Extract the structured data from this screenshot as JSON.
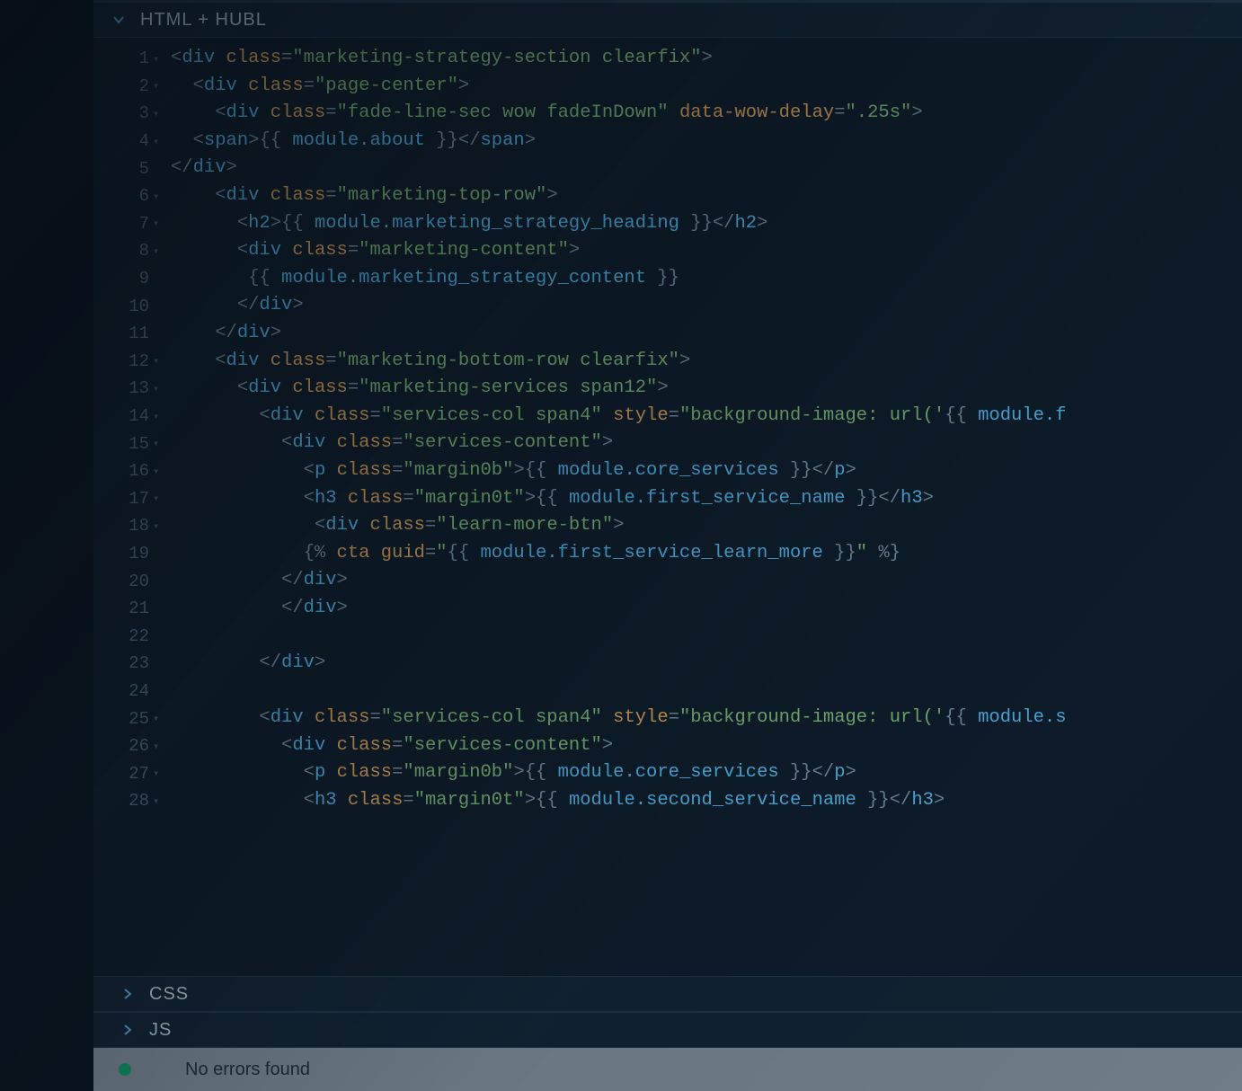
{
  "sections": {
    "html_hubl": "HTML + HUBL",
    "css": "CSS",
    "js": "JS"
  },
  "status_text": "No errors found",
  "code_lines": [
    {
      "n": 1,
      "fold": true,
      "tokens": [
        [
          "punc",
          "<"
        ],
        [
          "tag",
          "div"
        ],
        [
          "punc",
          " "
        ],
        [
          "attr",
          "class"
        ],
        [
          "eq",
          "="
        ],
        [
          "str",
          "\"marketing-strategy-section clearfix\""
        ],
        [
          "punc",
          ">"
        ]
      ]
    },
    {
      "n": 2,
      "fold": true,
      "indent": 2,
      "tokens": [
        [
          "punc",
          "<"
        ],
        [
          "tag",
          "div"
        ],
        [
          "punc",
          " "
        ],
        [
          "attr",
          "class"
        ],
        [
          "eq",
          "="
        ],
        [
          "str",
          "\"page-center\""
        ],
        [
          "punc",
          ">"
        ]
      ]
    },
    {
      "n": 3,
      "fold": true,
      "indent": 4,
      "tokens": [
        [
          "punc",
          "<"
        ],
        [
          "tag",
          "div"
        ],
        [
          "punc",
          " "
        ],
        [
          "attr",
          "class"
        ],
        [
          "eq",
          "="
        ],
        [
          "str",
          "\"fade-line-sec wow fadeInDown\""
        ],
        [
          "punc",
          " "
        ],
        [
          "attr",
          "data-wow-delay"
        ],
        [
          "eq",
          "="
        ],
        [
          "str",
          "\".25s\""
        ],
        [
          "punc",
          ">"
        ]
      ]
    },
    {
      "n": 4,
      "fold": true,
      "indent": 2,
      "tokens": [
        [
          "punc",
          "<"
        ],
        [
          "tag",
          "span"
        ],
        [
          "punc",
          ">"
        ],
        [
          "delim",
          "{{ "
        ],
        [
          "var",
          "module.about"
        ],
        [
          "delim",
          " }}"
        ],
        [
          "punc",
          "</"
        ],
        [
          "tag",
          "span"
        ],
        [
          "punc",
          ">"
        ]
      ]
    },
    {
      "n": 5,
      "fold": false,
      "indent": 0,
      "tokens": [
        [
          "punc",
          "</"
        ],
        [
          "tag",
          "div"
        ],
        [
          "punc",
          ">"
        ]
      ]
    },
    {
      "n": 6,
      "fold": true,
      "indent": 4,
      "tokens": [
        [
          "punc",
          "<"
        ],
        [
          "tag",
          "div"
        ],
        [
          "punc",
          " "
        ],
        [
          "attr",
          "class"
        ],
        [
          "eq",
          "="
        ],
        [
          "str",
          "\"marketing-top-row\""
        ],
        [
          "punc",
          ">"
        ]
      ]
    },
    {
      "n": 7,
      "fold": true,
      "indent": 6,
      "tokens": [
        [
          "punc",
          "<"
        ],
        [
          "tag",
          "h2"
        ],
        [
          "punc",
          ">"
        ],
        [
          "delim",
          "{{ "
        ],
        [
          "var",
          "module.marketing_strategy_heading"
        ],
        [
          "delim",
          " }}"
        ],
        [
          "punc",
          "</"
        ],
        [
          "tag",
          "h2"
        ],
        [
          "punc",
          ">"
        ]
      ]
    },
    {
      "n": 8,
      "fold": true,
      "indent": 6,
      "tokens": [
        [
          "punc",
          "<"
        ],
        [
          "tag",
          "div"
        ],
        [
          "punc",
          " "
        ],
        [
          "attr",
          "class"
        ],
        [
          "eq",
          "="
        ],
        [
          "str",
          "\"marketing-content\""
        ],
        [
          "punc",
          ">"
        ]
      ]
    },
    {
      "n": 9,
      "fold": false,
      "indent": 7,
      "tokens": [
        [
          "delim",
          "{{ "
        ],
        [
          "var",
          "module.marketing_strategy_content"
        ],
        [
          "delim",
          " }}"
        ]
      ]
    },
    {
      "n": 10,
      "fold": false,
      "indent": 6,
      "tokens": [
        [
          "punc",
          "</"
        ],
        [
          "tag",
          "div"
        ],
        [
          "punc",
          ">"
        ]
      ]
    },
    {
      "n": 11,
      "fold": false,
      "indent": 4,
      "tokens": [
        [
          "punc",
          "</"
        ],
        [
          "tag",
          "div"
        ],
        [
          "punc",
          ">"
        ]
      ]
    },
    {
      "n": 12,
      "fold": true,
      "indent": 4,
      "tokens": [
        [
          "punc",
          "<"
        ],
        [
          "tag",
          "div"
        ],
        [
          "punc",
          " "
        ],
        [
          "attr",
          "class"
        ],
        [
          "eq",
          "="
        ],
        [
          "str",
          "\"marketing-bottom-row clearfix\""
        ],
        [
          "punc",
          ">"
        ]
      ]
    },
    {
      "n": 13,
      "fold": true,
      "indent": 6,
      "tokens": [
        [
          "punc",
          "<"
        ],
        [
          "tag",
          "div"
        ],
        [
          "punc",
          " "
        ],
        [
          "attr",
          "class"
        ],
        [
          "eq",
          "="
        ],
        [
          "str",
          "\"marketing-services span12\""
        ],
        [
          "punc",
          ">"
        ]
      ]
    },
    {
      "n": 14,
      "fold": true,
      "indent": 8,
      "tokens": [
        [
          "punc",
          "<"
        ],
        [
          "tag",
          "div"
        ],
        [
          "punc",
          " "
        ],
        [
          "attr",
          "class"
        ],
        [
          "eq",
          "="
        ],
        [
          "str",
          "\"services-col span4\""
        ],
        [
          "punc",
          " "
        ],
        [
          "attr",
          "style"
        ],
        [
          "eq",
          "="
        ],
        [
          "str",
          "\"background-image: url('"
        ],
        [
          "delim",
          "{{ "
        ],
        [
          "var",
          "module.f"
        ]
      ]
    },
    {
      "n": 15,
      "fold": true,
      "indent": 10,
      "tokens": [
        [
          "punc",
          "<"
        ],
        [
          "tag",
          "div"
        ],
        [
          "punc",
          " "
        ],
        [
          "attr",
          "class"
        ],
        [
          "eq",
          "="
        ],
        [
          "str",
          "\"services-content\""
        ],
        [
          "punc",
          ">"
        ]
      ]
    },
    {
      "n": 16,
      "fold": true,
      "indent": 12,
      "tokens": [
        [
          "punc",
          "<"
        ],
        [
          "tag",
          "p"
        ],
        [
          "punc",
          " "
        ],
        [
          "attr",
          "class"
        ],
        [
          "eq",
          "="
        ],
        [
          "str",
          "\"margin0b\""
        ],
        [
          "punc",
          ">"
        ],
        [
          "delim",
          "{{ "
        ],
        [
          "var",
          "module.core_services"
        ],
        [
          "delim",
          " }}"
        ],
        [
          "punc",
          "</"
        ],
        [
          "tag",
          "p"
        ],
        [
          "punc",
          ">"
        ]
      ]
    },
    {
      "n": 17,
      "fold": true,
      "indent": 12,
      "tokens": [
        [
          "punc",
          "<"
        ],
        [
          "tag",
          "h3"
        ],
        [
          "punc",
          " "
        ],
        [
          "attr",
          "class"
        ],
        [
          "eq",
          "="
        ],
        [
          "str",
          "\"margin0t\""
        ],
        [
          "punc",
          ">"
        ],
        [
          "delim",
          "{{ "
        ],
        [
          "var",
          "module.first_service_name"
        ],
        [
          "delim",
          " }}"
        ],
        [
          "punc",
          "</"
        ],
        [
          "tag",
          "h3"
        ],
        [
          "punc",
          ">"
        ]
      ]
    },
    {
      "n": 18,
      "fold": true,
      "indent": 13,
      "tokens": [
        [
          "punc",
          "<"
        ],
        [
          "tag",
          "div"
        ],
        [
          "punc",
          " "
        ],
        [
          "attr",
          "class"
        ],
        [
          "eq",
          "="
        ],
        [
          "str",
          "\"learn-more-btn\""
        ],
        [
          "punc",
          ">"
        ]
      ]
    },
    {
      "n": 19,
      "fold": false,
      "indent": 12,
      "tokens": [
        [
          "delim",
          "{% "
        ],
        [
          "kw",
          "cta"
        ],
        [
          "punc",
          " "
        ],
        [
          "kw",
          "guid"
        ],
        [
          "eq",
          "="
        ],
        [
          "str",
          "\""
        ],
        [
          "delim",
          "{{ "
        ],
        [
          "var",
          "module.first_service_learn_more"
        ],
        [
          "delim",
          " }}"
        ],
        [
          "str",
          "\""
        ],
        [
          "delim",
          " %}"
        ]
      ]
    },
    {
      "n": 20,
      "fold": false,
      "indent": 10,
      "tokens": [
        [
          "punc",
          "</"
        ],
        [
          "tag",
          "div"
        ],
        [
          "punc",
          ">"
        ]
      ]
    },
    {
      "n": 21,
      "fold": false,
      "indent": 10,
      "tokens": [
        [
          "punc",
          "</"
        ],
        [
          "tag",
          "div"
        ],
        [
          "punc",
          ">"
        ]
      ]
    },
    {
      "n": 22,
      "fold": false,
      "indent": 0,
      "tokens": []
    },
    {
      "n": 23,
      "fold": false,
      "indent": 8,
      "tokens": [
        [
          "punc",
          "</"
        ],
        [
          "tag",
          "div"
        ],
        [
          "punc",
          ">"
        ]
      ]
    },
    {
      "n": 24,
      "fold": false,
      "indent": 0,
      "tokens": []
    },
    {
      "n": 25,
      "fold": true,
      "indent": 8,
      "tokens": [
        [
          "punc",
          "<"
        ],
        [
          "tag",
          "div"
        ],
        [
          "punc",
          " "
        ],
        [
          "attr",
          "class"
        ],
        [
          "eq",
          "="
        ],
        [
          "str",
          "\"services-col span4\""
        ],
        [
          "punc",
          " "
        ],
        [
          "attr",
          "style"
        ],
        [
          "eq",
          "="
        ],
        [
          "str",
          "\"background-image: url('"
        ],
        [
          "delim",
          "{{ "
        ],
        [
          "var",
          "module.s"
        ]
      ]
    },
    {
      "n": 26,
      "fold": true,
      "indent": 10,
      "tokens": [
        [
          "punc",
          "<"
        ],
        [
          "tag",
          "div"
        ],
        [
          "punc",
          " "
        ],
        [
          "attr",
          "class"
        ],
        [
          "eq",
          "="
        ],
        [
          "str",
          "\"services-content\""
        ],
        [
          "punc",
          ">"
        ]
      ]
    },
    {
      "n": 27,
      "fold": true,
      "indent": 12,
      "tokens": [
        [
          "punc",
          "<"
        ],
        [
          "tag",
          "p"
        ],
        [
          "punc",
          " "
        ],
        [
          "attr",
          "class"
        ],
        [
          "eq",
          "="
        ],
        [
          "str",
          "\"margin0b\""
        ],
        [
          "punc",
          ">"
        ],
        [
          "delim",
          "{{ "
        ],
        [
          "var",
          "module.core_services"
        ],
        [
          "delim",
          " }}"
        ],
        [
          "punc",
          "</"
        ],
        [
          "tag",
          "p"
        ],
        [
          "punc",
          ">"
        ]
      ]
    },
    {
      "n": 28,
      "fold": true,
      "indent": 12,
      "tokens": [
        [
          "punc",
          "<"
        ],
        [
          "tag",
          "h3"
        ],
        [
          "punc",
          " "
        ],
        [
          "attr",
          "class"
        ],
        [
          "eq",
          "="
        ],
        [
          "str",
          "\"margin0t\""
        ],
        [
          "punc",
          ">"
        ],
        [
          "delim",
          "{{ "
        ],
        [
          "var",
          "module.second_service_name"
        ],
        [
          "delim",
          " }}"
        ],
        [
          "punc",
          "</"
        ],
        [
          "tag",
          "h3"
        ],
        [
          "punc",
          ">"
        ]
      ]
    }
  ]
}
